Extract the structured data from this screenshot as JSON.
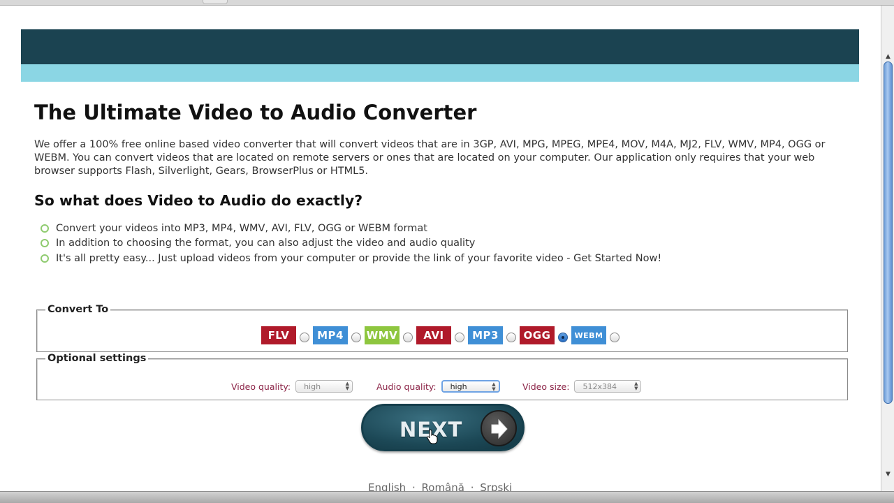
{
  "page": {
    "title": "The Ultimate Video to Audio Converter",
    "intro": "We offer a 100% free online based video converter that will convert videos that are in 3GP, AVI, MPG, MPEG, MPE4, MOV, M4A, MJ2, FLV, WMV, MP4, OGG or WEBM. You can convert videos that are located on remote servers or ones that are located on your computer. Our application only requires that your web browser supports Flash, Silverlight, Gears, BrowserPlus or HTML5.",
    "subtitle": "So what does Video to Audio do exactly?",
    "features": [
      "Convert your videos into MP3, MP4, WMV, AVI, FLV, OGG or WEBM format",
      "In addition to choosing the format, you can also adjust the video and audio quality",
      "It's all pretty easy... Just upload videos from your computer or provide the link of your favorite video - Get Started Now!"
    ]
  },
  "convert_to": {
    "legend": "Convert To",
    "selected": "OGG",
    "formats": [
      {
        "label": "FLV",
        "color": "#b01a2a"
      },
      {
        "label": "MP4",
        "color": "#3f8fd6"
      },
      {
        "label": "WMV",
        "color": "#8ec63f"
      },
      {
        "label": "AVI",
        "color": "#b01a2a"
      },
      {
        "label": "MP3",
        "color": "#3f8fd6"
      },
      {
        "label": "OGG",
        "color": "#b01a2a"
      },
      {
        "label": "WEBM",
        "color": "#3f8fd6"
      }
    ]
  },
  "optional_settings": {
    "legend": "Optional settings",
    "video_quality_label": "Video quality:",
    "video_quality_value": "high",
    "audio_quality_label": "Audio quality:",
    "audio_quality_value": "high",
    "video_size_label": "Video size:",
    "video_size_value": "512x384"
  },
  "next_button": {
    "label": "NEXT"
  },
  "languages": [
    "English",
    "Română",
    "Srpski"
  ],
  "colors": {
    "header_dark": "#1b4351",
    "header_light": "#8bd6e4",
    "bullet": "#8fcb6f",
    "option_label": "#8b2346"
  },
  "icons": {
    "next": "arrow-right-icon",
    "bullet": "circle-bullet-icon"
  }
}
